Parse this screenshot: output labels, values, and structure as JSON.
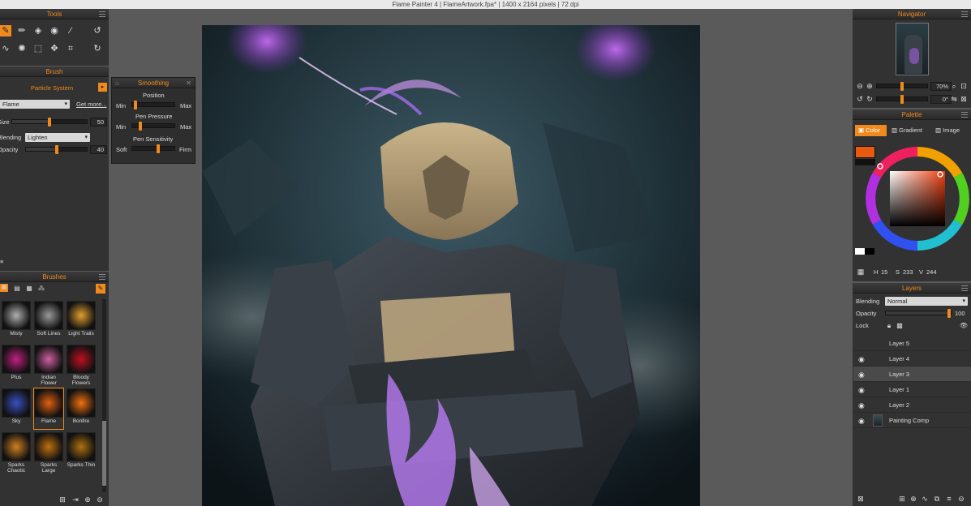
{
  "window": {
    "title": "Flame Painter 4 | FlameArtwork.fpa* | 1400 x 2164 pixels | 72 dpi"
  },
  "tools": {
    "title": "Tools",
    "icons": [
      "brush-icon",
      "pencil-icon",
      "eraser-icon",
      "fill-icon",
      "eyedropper-icon",
      "rotate-icon",
      "curve-icon",
      "sparkle-icon",
      "selection-icon",
      "transform-icon",
      "crop-icon",
      "redo-icon"
    ]
  },
  "brush": {
    "title": "Brush",
    "type": "Particle System",
    "preset": "Flame",
    "get_more": "Get more...",
    "size_label": "Size",
    "size_value": "50",
    "size_level": 0.5,
    "blending_label": "Blending",
    "blending_value": "Lighten",
    "opacity_label": "Opacity",
    "opacity_value": "40",
    "opacity_level": 0.5
  },
  "smoothing": {
    "title": "Smoothing",
    "position_label": "Position",
    "pen_pressure_label": "Pen Pressure",
    "pen_sensitivity_label": "Pen Sensitivity",
    "min": "Min",
    "max": "Max",
    "soft": "Soft",
    "firm": "Firm"
  },
  "brushes": {
    "title": "Brushes",
    "items": [
      {
        "name": "Misty",
        "color": "#b0b0b0"
      },
      {
        "name": "Soft Lines",
        "color": "#9a9a9a"
      },
      {
        "name": "Light Trails",
        "color": "#e0a030"
      },
      {
        "name": "Plus",
        "color": "#c02080"
      },
      {
        "name": "Indian Flower",
        "color": "#d060a0"
      },
      {
        "name": "Bloody Flowers",
        "color": "#c01020"
      },
      {
        "name": "Sky",
        "color": "#3a50c0"
      },
      {
        "name": "Flame",
        "color": "#e06010"
      },
      {
        "name": "Bonfire",
        "color": "#f07010"
      },
      {
        "name": "Sparks Chaotic",
        "color": "#d08020"
      },
      {
        "name": "Sparks Large",
        "color": "#c07010"
      },
      {
        "name": "Sparks Thin",
        "color": "#b07010"
      }
    ]
  },
  "navigator": {
    "title": "Navigator",
    "zoom_value": "70%",
    "rotation_value": "0°",
    "zoom_level": 0.5,
    "rotation_level": 0.5
  },
  "palette": {
    "title": "Palette",
    "tabs": [
      "Color",
      "Gradient",
      "Image"
    ],
    "active_tab": "Color",
    "swatch_color": "#e85a10",
    "h_label": "H",
    "h_value": "15",
    "s_label": "S",
    "s_value": "233",
    "v_label": "V",
    "v_value": "244"
  },
  "layers": {
    "title": "Layers",
    "blending_label": "Blending",
    "blending_value": "Normal",
    "opacity_label": "Opacity",
    "opacity_value": "100",
    "opacity_level": 1.0,
    "lock_label": "Lock",
    "items": [
      {
        "name": "Layer 5",
        "selected": false,
        "eye": false
      },
      {
        "name": "Layer 4",
        "selected": false,
        "eye": true
      },
      {
        "name": "Layer 3",
        "selected": true,
        "eye": true
      },
      {
        "name": "Layer 1",
        "selected": false,
        "eye": true
      },
      {
        "name": "Layer 2",
        "selected": false,
        "eye": true
      },
      {
        "name": "Painting Comp",
        "selected": false,
        "eye": true
      }
    ]
  },
  "colors": {
    "accent": "#f08a1c",
    "panel": "#323232",
    "workspace": "#5a5a5a"
  }
}
